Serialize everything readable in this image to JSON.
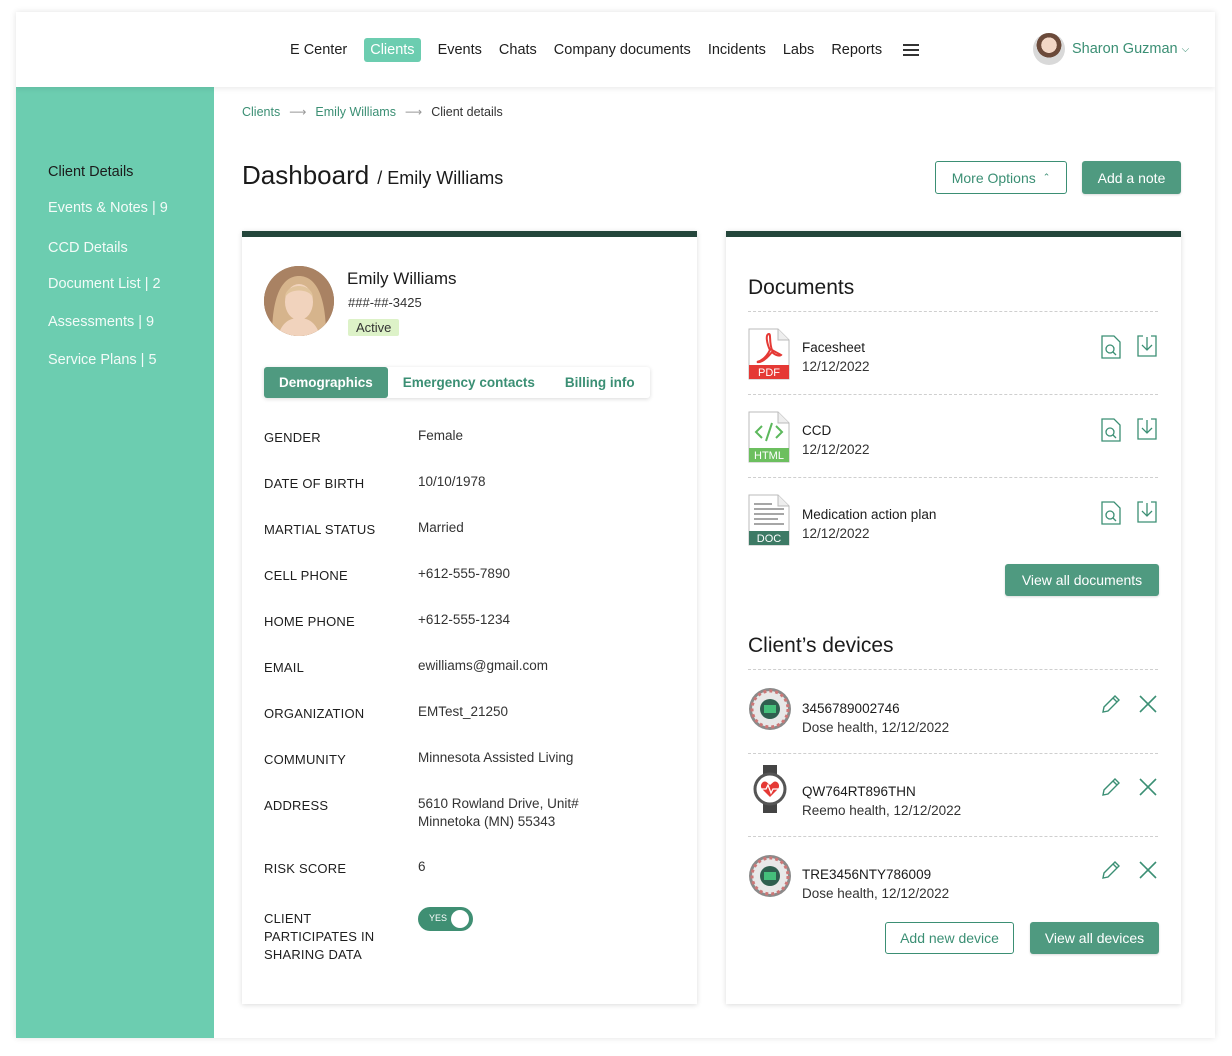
{
  "nav": {
    "items": [
      "E Center",
      "Clients",
      "Events",
      "Chats",
      "Company documents",
      "Incidents",
      "Labs",
      "Reports"
    ],
    "active": "Clients",
    "user_name": "Sharon Guzman"
  },
  "sidebar": {
    "items": [
      {
        "label": "Client Details"
      },
      {
        "label": "Events & Notes | 9"
      },
      {
        "label": "CCD Details"
      },
      {
        "label": "Document List | 2"
      },
      {
        "label": "Assessments | 9"
      },
      {
        "label": "Service Plans | 5"
      }
    ]
  },
  "breadcrumb": {
    "items": [
      "Clients",
      "Emily Williams",
      "Client details"
    ],
    "separator": "⟶"
  },
  "page": {
    "title": "Dashboard",
    "subtitle": "/ Emily Williams",
    "more_options": "More Options",
    "add_note": "Add a note"
  },
  "profile": {
    "name": "Emily Williams",
    "ssn": "###-##-3425",
    "status": "Active",
    "tabs": [
      "Demographics",
      "Emergency contacts",
      "Billing info"
    ],
    "fields": [
      {
        "label": "GENDER",
        "value": "Female"
      },
      {
        "label": "DATE OF BIRTH",
        "value": "10/10/1978"
      },
      {
        "label": "MARTIAL STATUS",
        "value": "Married"
      },
      {
        "label": "CELL PHONE",
        "value": "+612-555-7890"
      },
      {
        "label": "HOME PHONE",
        "value": "+612-555-1234"
      },
      {
        "label": "EMAIL",
        "value": "ewilliams@gmail.com"
      },
      {
        "label": "ORGANIZATION",
        "value": "EMTest_21250"
      },
      {
        "label": "COMMUNITY",
        "value": "Minnesota Assisted Living"
      },
      {
        "label": "ADDRESS",
        "value": "5610 Rowland Drive, Unit#",
        "value2": "Minnetoka (MN) 55343"
      },
      {
        "label": "RISK SCORE",
        "value": "6"
      },
      {
        "label": "CLIENT",
        "label2": "PARTICIPATES IN",
        "label3": "SHARING DATA",
        "toggle": "YES"
      }
    ]
  },
  "documents": {
    "title": "Documents",
    "items": [
      {
        "name": "Facesheet",
        "date": "12/12/2022",
        "type": "PDF"
      },
      {
        "name": "CCD",
        "date": "12/12/2022",
        "type": "HTML"
      },
      {
        "name": "Medication action plan",
        "date": "12/12/2022",
        "type": "DOC"
      }
    ],
    "view_all": "View all documents"
  },
  "devices": {
    "title": "Client’s devices",
    "items": [
      {
        "id": "3456789002746",
        "info": "Dose health, 12/12/2022",
        "icon": "pill-dispenser-icon"
      },
      {
        "id": "QW764RT896THN",
        "info": "Reemo health, 12/12/2022",
        "icon": "smartwatch-icon"
      },
      {
        "id": "TRE3456NTY786009",
        "info": "Dose health, 12/12/2022",
        "icon": "pill-dispenser-icon"
      }
    ],
    "add_new": "Add new device",
    "view_all": "View all devices"
  },
  "colors": {
    "accent": "#6ccdb0",
    "primary": "#4f9a80",
    "dark": "#24463b",
    "link": "#3b8f74"
  }
}
